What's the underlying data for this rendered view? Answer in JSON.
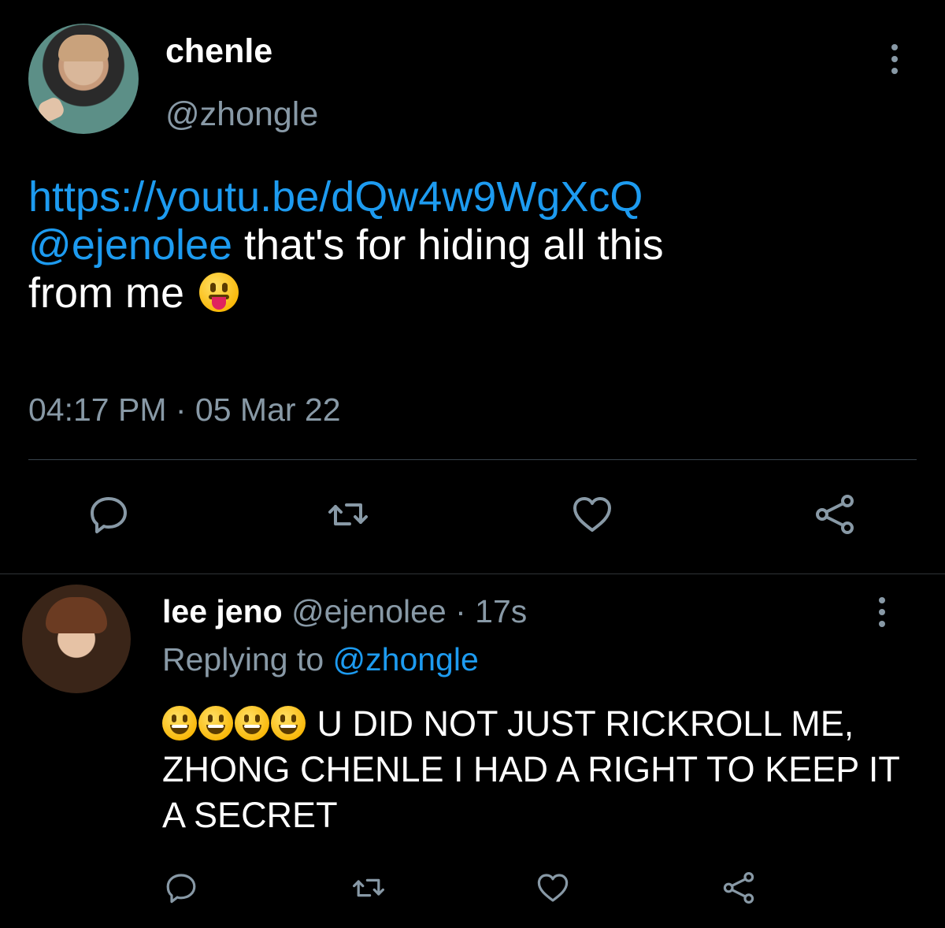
{
  "tweet": {
    "display_name": "chenle",
    "handle": "@zhongle",
    "link": "https://youtu.be/dQw4w9WgXcQ",
    "mention": "@ejenolee",
    "text_line1_rest": " that's for hiding all this",
    "text_line2": "from me ",
    "emoji": "face-with-tongue",
    "timestamp": "04:17 PM · 05 Mar 22",
    "icons": [
      "reply-icon",
      "retweet-icon",
      "like-icon",
      "share-icon",
      "more-options-icon"
    ]
  },
  "reply": {
    "display_name": "lee jeno",
    "meta": " @ejenolee · 17s",
    "replying_prefix": "Replying to ",
    "replying_handle": "@zhongle",
    "emoji": "grinning-face",
    "emoji_count": 4,
    "text": " U DID NOT JUST RICKROLL ME, ZHONG CHENLE I HAD A RIGHT TO KEEP IT A SECRET",
    "icons": [
      "reply-icon",
      "retweet-icon",
      "like-icon",
      "share-icon",
      "more-options-icon"
    ]
  },
  "colors": {
    "background": "#000000",
    "link": "#1d9bf0",
    "secondary_text": "#8899a6",
    "divider": "#38444d"
  }
}
